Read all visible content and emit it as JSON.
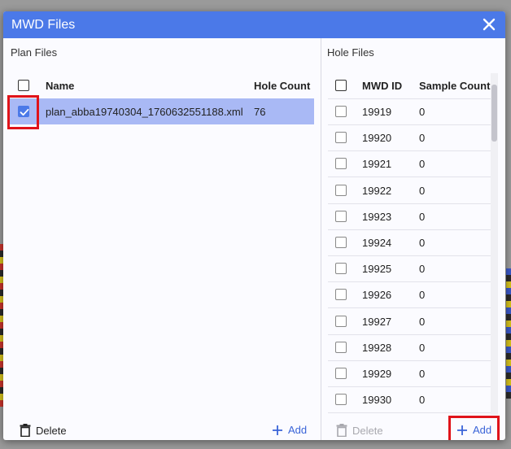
{
  "dialog": {
    "title": "MWD Files"
  },
  "plan_files": {
    "label": "Plan Files",
    "columns": {
      "name": "Name",
      "hole_count": "Hole Count"
    },
    "rows": [
      {
        "name": "plan_abba19740304_1760632551188.xml",
        "hole_count": "76",
        "checked": true
      }
    ],
    "delete_label": "Delete",
    "add_label": "Add"
  },
  "hole_files": {
    "label": "Hole Files",
    "columns": {
      "mwd_id": "MWD ID",
      "sample_count": "Sample Count"
    },
    "rows": [
      {
        "mwd_id": "19919",
        "sample_count": "0"
      },
      {
        "mwd_id": "19920",
        "sample_count": "0"
      },
      {
        "mwd_id": "19921",
        "sample_count": "0"
      },
      {
        "mwd_id": "19922",
        "sample_count": "0"
      },
      {
        "mwd_id": "19923",
        "sample_count": "0"
      },
      {
        "mwd_id": "19924",
        "sample_count": "0"
      },
      {
        "mwd_id": "19925",
        "sample_count": "0"
      },
      {
        "mwd_id": "19926",
        "sample_count": "0"
      },
      {
        "mwd_id": "19927",
        "sample_count": "0"
      },
      {
        "mwd_id": "19928",
        "sample_count": "0"
      },
      {
        "mwd_id": "19929",
        "sample_count": "0"
      },
      {
        "mwd_id": "19930",
        "sample_count": "0"
      }
    ],
    "delete_label": "Delete",
    "add_label": "Add"
  },
  "colors": {
    "accent": "#4b79e8",
    "selected_row": "#a9b9f5",
    "annotation": "#e0131a"
  }
}
